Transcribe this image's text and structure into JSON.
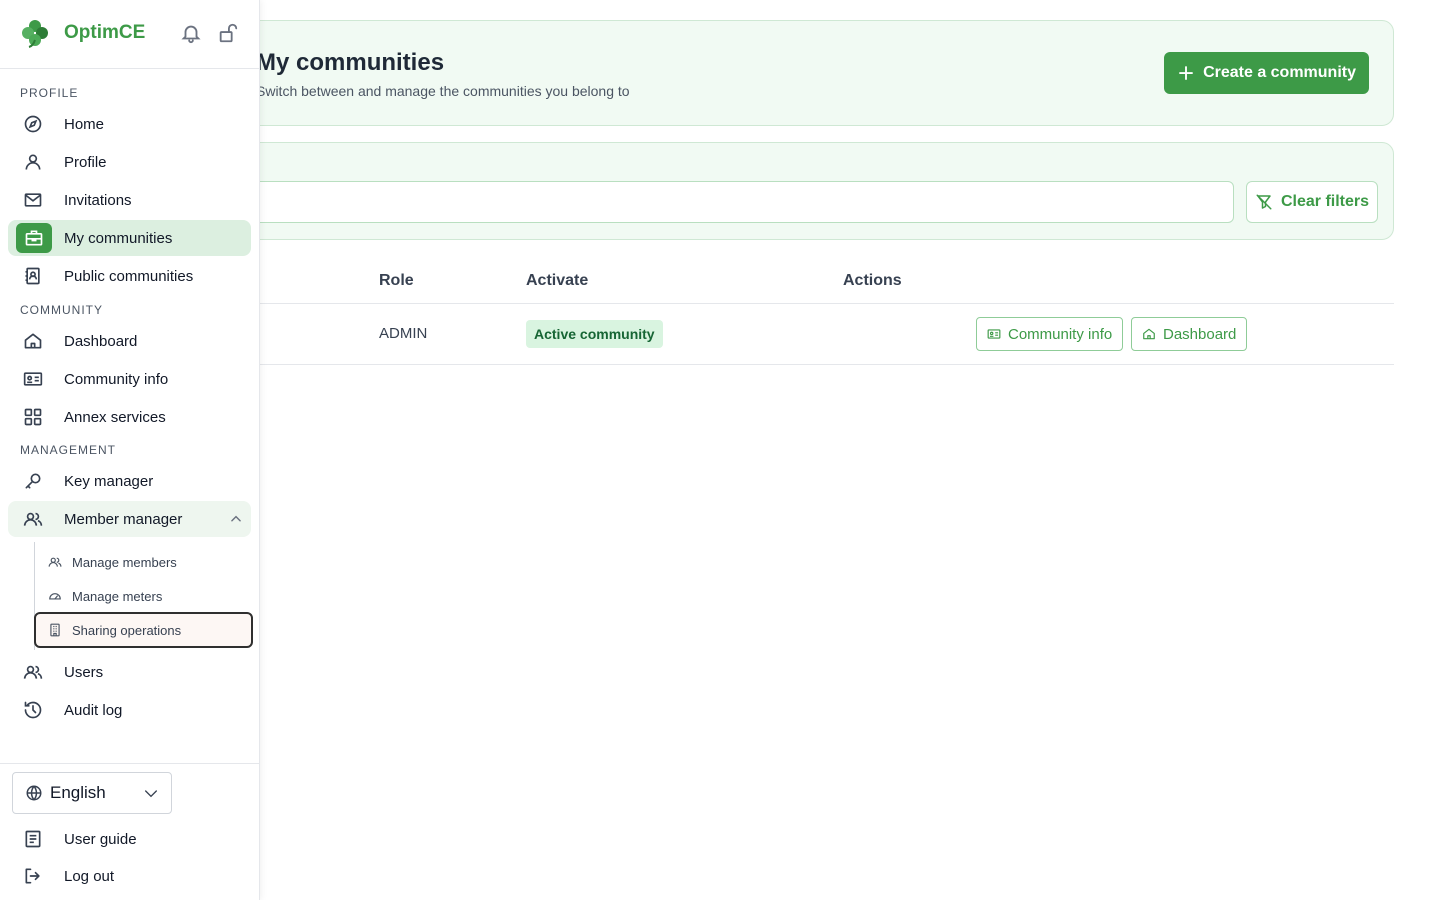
{
  "header": {
    "title": "My communities",
    "subtitle": "Switch between and manage the communities you belong to",
    "create_label": "Create a community"
  },
  "filters": {
    "search_placeholder": "",
    "clear_label": "Clear filters"
  },
  "table": {
    "headers": {
      "role": "Role",
      "activate": "Activate",
      "actions": "Actions"
    },
    "rows": [
      {
        "role": "ADMIN",
        "status": "Active community",
        "info_label": "Community info",
        "dashboard_label": "Dashboard"
      }
    ]
  },
  "sidebar": {
    "brand": "OptimCE",
    "sections": {
      "profile": "PROFILE",
      "community": "COMMUNITY",
      "management": "MANAGEMENT"
    },
    "items": {
      "home": "Home",
      "profile": "Profile",
      "invitations": "Invitations",
      "my_communities": "My communities",
      "public_communities": "Public communities",
      "dashboard": "Dashboard",
      "community_info": "Community info",
      "annex_services": "Annex services",
      "key_manager": "Key manager",
      "member_manager": "Member manager",
      "manage_members": "Manage members",
      "manage_meters": "Manage meters",
      "sharing_operations": "Sharing operations",
      "users": "Users",
      "audit_log": "Audit log"
    },
    "language": "English",
    "user_guide": "User guide",
    "logout": "Log out"
  },
  "colors": {
    "brand": "#3d9a47",
    "active_bg": "#dcefe0",
    "card_bg": "#f1faf3"
  }
}
